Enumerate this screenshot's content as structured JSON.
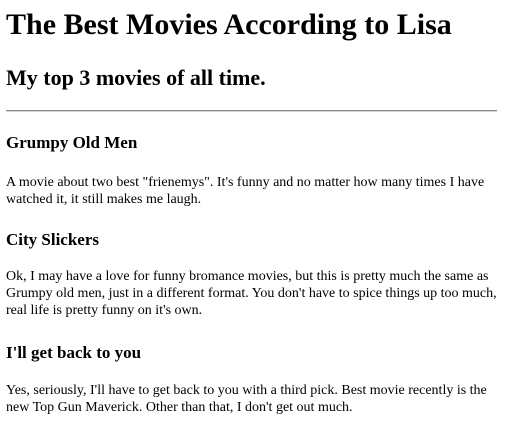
{
  "page": {
    "title": "The Best Movies According to Lisa",
    "subtitle": "My top 3 movies of all time."
  },
  "movies": [
    {
      "title": "Grumpy Old Men",
      "description": "A movie about two best \"frienemys\". It's funny and no matter how many times I have watched it, it still makes me laugh."
    },
    {
      "title": "City Slickers",
      "description": "Ok, I may have a love for funny bromance movies, but this is pretty much the same as Grumpy old men, just in a different format. You don't have to spice things up too much, real life is pretty funny on it's own."
    },
    {
      "title": "I'll get back to you",
      "description": "Yes, seriously, I'll have to get back to you with a third pick. Best movie recently is the new Top Gun Maverick. Other than that, I don't get out much."
    }
  ]
}
